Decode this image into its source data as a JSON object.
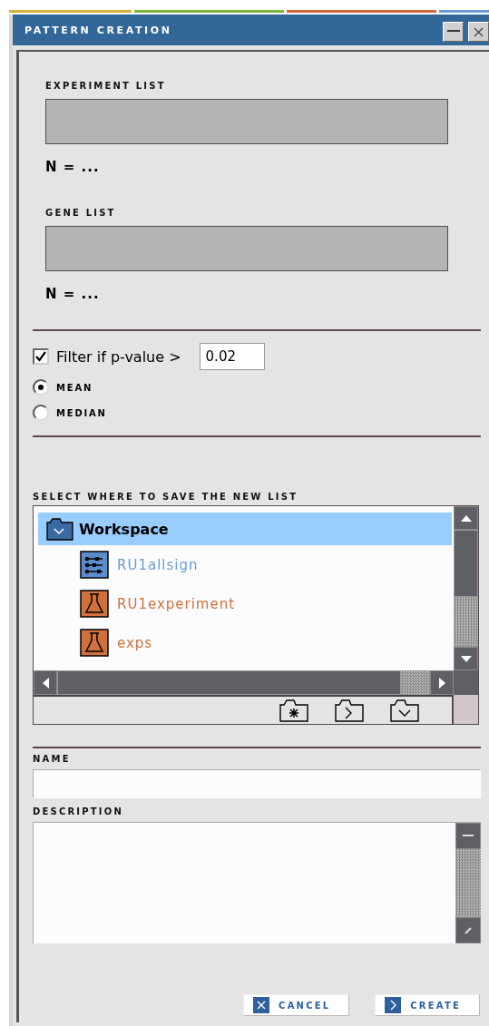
{
  "window": {
    "title": "PATTERN CREATION"
  },
  "experiment_list": {
    "label": "EXPERIMENT LIST",
    "count": "N = ..."
  },
  "gene_list": {
    "label": "GENE LIST",
    "count": "N = ..."
  },
  "filter": {
    "checked": true,
    "label": "Filter if p-value >",
    "value": "0.02"
  },
  "statistic": [
    {
      "label": "MEAN",
      "selected": true
    },
    {
      "label": "MEDIAN",
      "selected": false
    }
  ],
  "save_location": {
    "label": "SELECT WHERE TO SAVE THE NEW LIST",
    "tree": [
      {
        "name": "Workspace",
        "kind": "folder",
        "selected": true,
        "expanded": true,
        "children": [
          {
            "name": "RU1allsign",
            "kind": "gene_list",
            "selected": false
          },
          {
            "name": "RU1experiment",
            "kind": "experiment",
            "selected": false
          },
          {
            "name": "exps",
            "kind": "experiment",
            "selected": false
          }
        ]
      }
    ]
  },
  "name_field": {
    "label": "NAME"
  },
  "description_field": {
    "label": "DESCRIPTION"
  },
  "buttons": [
    {
      "label": "CANCEL",
      "kind": "cancel"
    },
    {
      "label": "CREATE",
      "kind": "create"
    }
  ]
}
